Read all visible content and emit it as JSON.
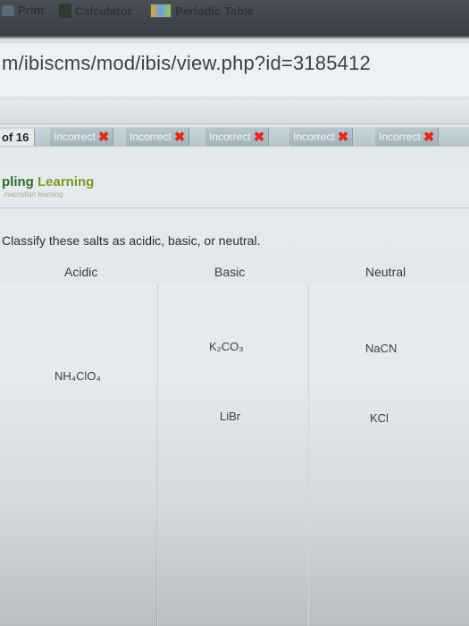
{
  "browser": {
    "url": "m/ibiscms/mod/ibis/view.php?id=3185412"
  },
  "toolbar": {
    "print": "Print",
    "calculator": "Calculator",
    "periodic_table": "Periodic Table"
  },
  "progress": {
    "page_count": "of 16"
  },
  "tabs": [
    {
      "label": "Incorrect"
    },
    {
      "label": "Incorrect"
    },
    {
      "label": "Incorrect"
    },
    {
      "label": "Incorrect"
    },
    {
      "label": "Incorrect"
    }
  ],
  "brand": {
    "name_main": "pling",
    "name_accent": " Learning",
    "tagline": "macmillan learning"
  },
  "question": {
    "prompt": "Classify these salts as acidic, basic, or neutral.",
    "columns": [
      "Acidic",
      "Basic",
      "Neutral"
    ]
  },
  "items": [
    {
      "label": "K₂CO₃"
    },
    {
      "label": "NaCN"
    },
    {
      "label": "NH₄ClO₄"
    },
    {
      "label": "LiBr"
    },
    {
      "label": "KCl"
    }
  ],
  "colors": {
    "incorrect": "#e02a20",
    "brand_green": "#2f6b2a"
  }
}
